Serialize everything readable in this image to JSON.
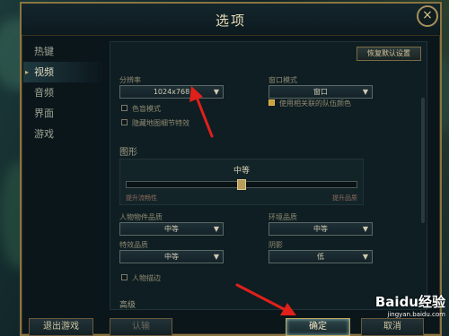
{
  "window": {
    "title": "选项",
    "close_glyph": "×"
  },
  "sidebar": {
    "items": [
      {
        "label": "热键",
        "active": false
      },
      {
        "label": "视频",
        "active": true
      },
      {
        "label": "音频",
        "active": false
      },
      {
        "label": "界面",
        "active": false
      },
      {
        "label": "游戏",
        "active": false
      }
    ]
  },
  "video": {
    "reset_label": "恢复默认设置",
    "resolution": {
      "label": "分辨率",
      "value": "1024x768"
    },
    "window_mode": {
      "label": "窗口模式",
      "value": "窗口"
    },
    "color_mode": {
      "label": "色盲模式",
      "checked": false
    },
    "hide_eye_candy": {
      "label": "隐藏地图细节特效",
      "checked": false
    },
    "relative_team_colors": {
      "label": "使用相关联的队伍颜色",
      "checked": true
    }
  },
  "graphics": {
    "section_label": "图形",
    "preset_label": "中等",
    "preset_level": 0.5,
    "low_label": "提升流畅性",
    "high_label": "提升品质",
    "character_quality": {
      "label": "人物物件品质",
      "value": "中等"
    },
    "environment_quality": {
      "label": "环境品质",
      "value": "中等"
    },
    "effects_quality": {
      "label": "特效品质",
      "value": "中等"
    },
    "shadows": {
      "label": "阴影",
      "value": "低"
    },
    "character_inking": {
      "label": "人物描边",
      "checked": false
    },
    "advanced_label": "高级"
  },
  "footer": {
    "exit_label": "退出游戏",
    "surrender_label": "认输",
    "ok_label": "确定",
    "cancel_label": "取消"
  },
  "watermark": {
    "brand": "Baidu经验",
    "url": "jingyan.baidu.com"
  },
  "colors": {
    "accent_gold": "#c9a23c",
    "annotation_red": "#e0201a"
  },
  "icons": {
    "caret": "▼",
    "nav_arrow": "▸"
  }
}
